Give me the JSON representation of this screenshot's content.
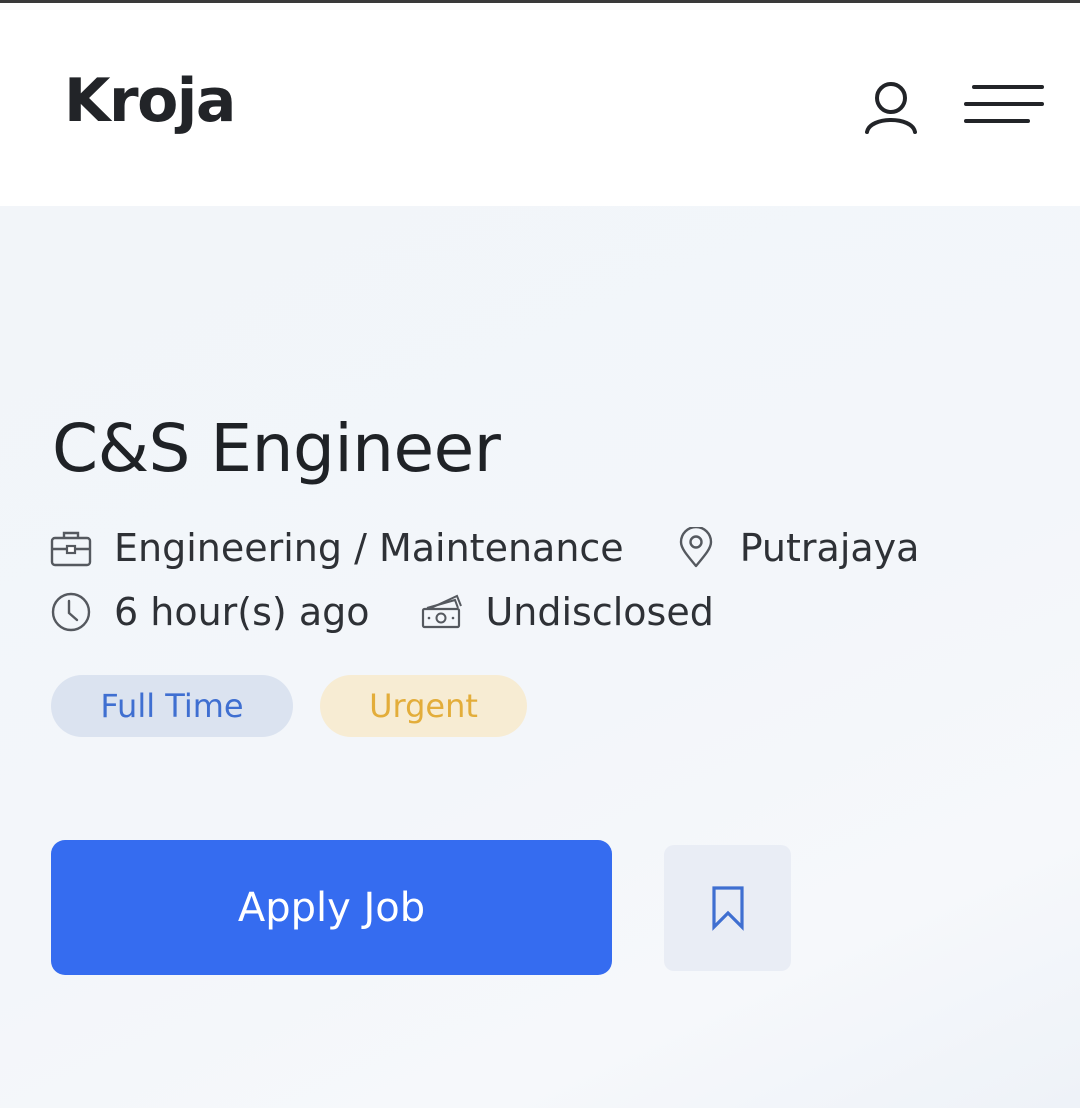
{
  "header": {
    "logo": "Kroja",
    "icons": {
      "user": "user-icon",
      "menu": "hamburger-menu-icon"
    }
  },
  "job": {
    "title": "C&S Engineer",
    "category": "Engineering / Maintenance",
    "location": "Putrajaya",
    "posted": "6 hour(s) ago",
    "salary": "Undisclosed",
    "tags": [
      {
        "label": "Full Time",
        "color": "#3f6fd1",
        "bg": "#dbe3f0"
      },
      {
        "label": "Urgent",
        "color": "#e3ad3a",
        "bg": "#f7ecd3"
      }
    ]
  },
  "actions": {
    "apply_label": "Apply Job",
    "bookmark_icon": "bookmark-icon"
  },
  "colors": {
    "primary": "#356cf0",
    "text": "#222428",
    "hero_bg": "#f3f6fa"
  }
}
